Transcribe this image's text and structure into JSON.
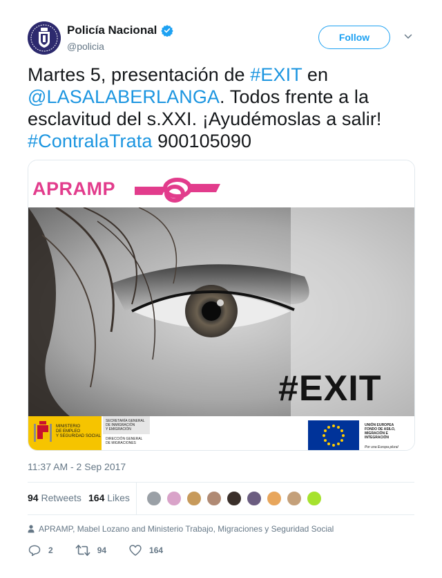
{
  "account": {
    "name": "Policía Nacional",
    "handle": "@policia",
    "follow_label": "Follow"
  },
  "tweet": {
    "part1": "Martes 5, presentación de ",
    "hashtag_exit": "#EXIT",
    "part2": " en",
    "mention": "@LASALABERLANGA",
    "part3": ". Todos frente a la esclavitud del s.XXI. ¡Ayudémoslas a salir!",
    "hashtag_trata": "#ContralaTrata",
    "phone": " 900105090"
  },
  "media": {
    "brand": "APRAMP",
    "exit_tag": "#EXIT",
    "gov_lines": [
      "MINISTERIO",
      "DE EMPLEO",
      "Y SEGURIDAD SOCIAL"
    ],
    "sec_lines": [
      "SECRETARÍA GENERAL",
      "DE INMIGRACIÓN",
      "Y EMIGRACIÓN"
    ],
    "dir_lines": [
      "DIRECCIÓN GENERAL",
      "DE MIGRACIONES"
    ],
    "eu_lines": [
      "UNIÓN EUROPEA",
      "FONDO DE ASILO,",
      "MIGRACIÓN E",
      "INTEGRACIÓN"
    ],
    "eu_motto": "Por una Europa plural"
  },
  "timestamp": "11:37 AM - 2 Sep 2017",
  "stats": {
    "retweets_count": "94",
    "retweets_label": "Retweets",
    "likes_count": "164",
    "likes_label": "Likes"
  },
  "liker_colors": [
    "#9aa0a6",
    "#d9a3c9",
    "#c79a5b",
    "#b08a74",
    "#3a2f2a",
    "#6b5d80",
    "#e8a65c",
    "#c4a07a",
    "#a6e22e"
  ],
  "context": "APRAMP, Mabel Lozano and Ministerio Trabajo, Migraciones y Seguridad Social",
  "actions": {
    "reply_count": "2",
    "retweet_count": "94",
    "like_count": "164"
  },
  "colors": {
    "accent": "#1da1f2",
    "link": "#1b95e0",
    "brand_pink": "#e23c8c"
  }
}
